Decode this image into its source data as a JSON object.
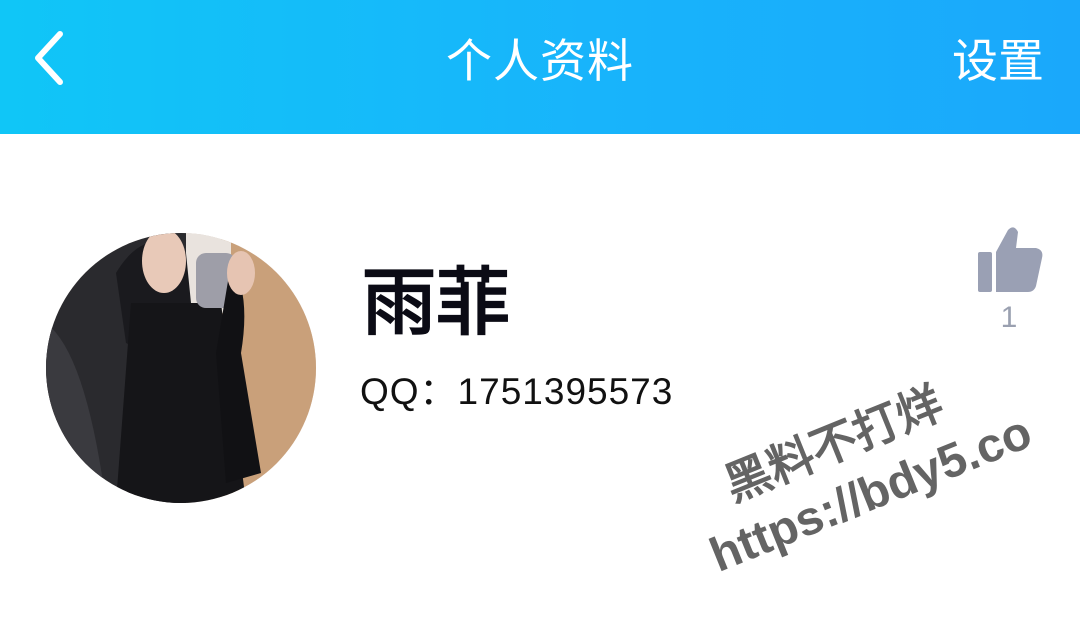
{
  "header": {
    "title": "个人资料",
    "settings_label": "设置",
    "back_icon": "chevron-left-icon",
    "background_colors": [
      "#10c6f7",
      "#1aa8fb"
    ]
  },
  "profile": {
    "name": "雨菲",
    "qq": "QQ：1751395573",
    "like_icon": "thumbs-up-icon",
    "like_count": "1"
  },
  "watermark": {
    "line1": "黑料不打烊",
    "line2": "https://bdy5.co"
  }
}
